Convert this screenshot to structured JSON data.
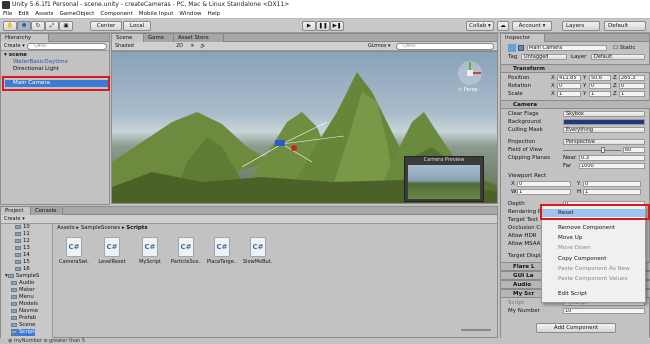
{
  "window": {
    "title": "Unity 5.6.1f1 Personal - scene.unity - createCameras - PC, Mac & Linux Standalone <DX11>"
  },
  "menu": [
    "File",
    "Edit",
    "Assets",
    "GameObject",
    "Component",
    "Mobile Input",
    "Window",
    "Help"
  ],
  "toolbar": {
    "center": "Center",
    "local": "Local",
    "collab": "Collab ▾",
    "account": "Account ▾",
    "layers": "Layers",
    "layout": "Default"
  },
  "hierarchy": {
    "tab": "Hierarchy",
    "create": "Create ▾",
    "search": "Q▾All",
    "scene": "scene",
    "items": [
      "WaterBasicDaytime",
      "Directional Light",
      "",
      "Main Camera"
    ]
  },
  "scene_view": {
    "tabs": [
      "Scene",
      "Game",
      "Asset Store"
    ],
    "shading": "Shaded",
    "mode2d": "2D",
    "gizmos": "Gizmos ▾",
    "search": "Q▾All",
    "persp": "< Persp",
    "preview": "Camera Preview"
  },
  "inspector": {
    "tab": "Inspector",
    "name": "Main Camera",
    "static": "Static",
    "tag_label": "Tag",
    "tag": "Untagged",
    "layer_label": "Layer",
    "layer": "Default",
    "transform": {
      "title": "Transform",
      "rows": [
        {
          "label": "Position",
          "x": "411.85",
          "y": "50.6",
          "z": "285.3"
        },
        {
          "label": "Rotation",
          "x": "0",
          "y": "0",
          "z": "0"
        },
        {
          "label": "Scale",
          "x": "1",
          "y": "1",
          "z": "1"
        }
      ]
    },
    "camera": {
      "title": "Camera",
      "clear_flags": "Skybox",
      "culling_mask": "Everything",
      "projection": "Perspective",
      "fov": "60",
      "near": "0.3",
      "far": "1000",
      "labels": {
        "clear_flags": "Clear Flags",
        "background": "Background",
        "culling_mask": "Culling Mask",
        "projection": "Projection",
        "fov": "Field of View",
        "clipping": "Clipping Planes",
        "near": "Near",
        "far": "Far",
        "viewport": "Viewport Rect",
        "x": "X",
        "y": "Y",
        "w": "W",
        "h": "H",
        "depth": "Depth",
        "rendering": "Rendering P",
        "target_texture": "Target Text",
        "occlusion": "Occlusion Cu",
        "allow_hdr": "Allow HDR",
        "allow_msaa": "Allow MSAA",
        "target_display": "Target Displa"
      },
      "vx": "0",
      "vy": "0",
      "vw": "1",
      "vh": "1",
      "depth": "0"
    },
    "components": [
      "Flare L",
      "GUI La",
      "Audio",
      "My Scr"
    ],
    "script_label": "Script",
    "script_value": "MyScript",
    "my_number_label": "My Number",
    "my_number": "10",
    "add_component": "Add Component"
  },
  "context_menu": [
    {
      "label": "Reset",
      "enabled": true
    },
    {
      "label": "Remove Component",
      "enabled": true
    },
    {
      "label": "Move Up",
      "enabled": true
    },
    {
      "label": "Move Down",
      "enabled": false
    },
    {
      "label": "Copy Component",
      "enabled": true
    },
    {
      "label": "Paste Component As New",
      "enabled": false
    },
    {
      "label": "Paste Component Values",
      "enabled": false
    },
    {
      "label": "Edit Script",
      "enabled": true
    }
  ],
  "project": {
    "tabs": [
      "Project",
      "Console"
    ],
    "create": "Create ▾",
    "breadcrumb": [
      "Assets",
      "SampleScenes",
      "Scripts"
    ],
    "tree": [
      "10",
      "11",
      "12",
      "13",
      "14",
      "15",
      "16",
      "SampleS",
      "Audio",
      "Mater",
      "Menu",
      "Models",
      "Navme",
      "Prefab",
      "Scene",
      "Script"
    ],
    "assets": [
      "CameraSwi...",
      "LevelReset",
      "MyScript",
      "ParticleSce...",
      "PlaceTarge...",
      "SlowMoBut..."
    ]
  },
  "status": "myNumber is greater than 5"
}
